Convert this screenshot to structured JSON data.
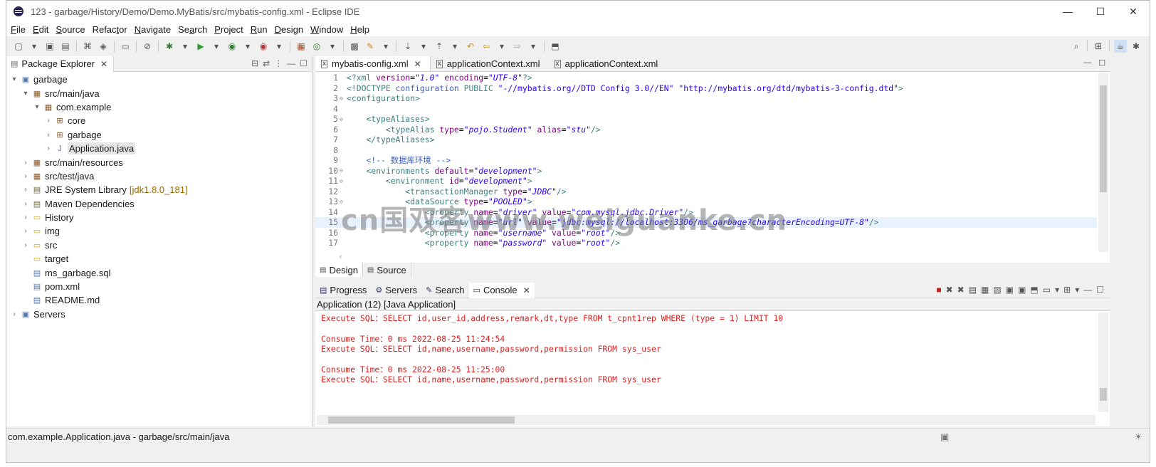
{
  "window": {
    "title": "123 - garbage/History/Demo/Demo.MyBatis/src/mybatis-config.xml - Eclipse IDE",
    "minimize": "—",
    "maximize": "☐",
    "close": "✕"
  },
  "menu": [
    {
      "mnemonic": "F",
      "rest": "ile"
    },
    {
      "mnemonic": "E",
      "rest": "dit"
    },
    {
      "mnemonic": "S",
      "rest": "ource"
    },
    {
      "mnemonic": "",
      "rest": "Refac",
      "u": "t",
      "tail": "or"
    },
    {
      "mnemonic": "N",
      "rest": "avigate"
    },
    {
      "mnemonic": "",
      "rest": "Se",
      "u": "a",
      "tail": "rch"
    },
    {
      "mnemonic": "P",
      "rest": "roject"
    },
    {
      "mnemonic": "R",
      "rest": "un"
    },
    {
      "mnemonic": "D",
      "rest": "esign"
    },
    {
      "mnemonic": "W",
      "rest": "indow"
    },
    {
      "mnemonic": "H",
      "rest": "elp"
    }
  ],
  "package_explorer": {
    "tab_label": "Package Explorer",
    "tree": [
      {
        "indent": 0,
        "twisty": "▾",
        "icon": "project-icon",
        "glyph": "▣",
        "label": "garbage"
      },
      {
        "indent": 1,
        "twisty": "▾",
        "icon": "source-folder-icon",
        "glyph": "▦",
        "label": "src/main/java"
      },
      {
        "indent": 2,
        "twisty": "▾",
        "icon": "package-icon",
        "glyph": "▦",
        "label": "com.example"
      },
      {
        "indent": 3,
        "twisty": "›",
        "icon": "package-icon",
        "glyph": "⊞",
        "label": "core"
      },
      {
        "indent": 3,
        "twisty": "›",
        "icon": "package-icon",
        "glyph": "⊞",
        "label": "garbage"
      },
      {
        "indent": 3,
        "twisty": "›",
        "icon": "java-file-icon",
        "glyph": "J",
        "label": "Application.java",
        "selected": true
      },
      {
        "indent": 1,
        "twisty": "›",
        "icon": "source-folder-icon",
        "glyph": "▦",
        "label": "src/main/resources"
      },
      {
        "indent": 1,
        "twisty": "›",
        "icon": "source-folder-icon",
        "glyph": "▦",
        "label": "src/test/java"
      },
      {
        "indent": 1,
        "twisty": "›",
        "icon": "library-icon",
        "glyph": "▤",
        "label": "JRE System Library",
        "suffix": "[jdk1.8.0_181]"
      },
      {
        "indent": 1,
        "twisty": "›",
        "icon": "library-icon",
        "glyph": "▤",
        "label": "Maven Dependencies"
      },
      {
        "indent": 1,
        "twisty": "›",
        "icon": "folder-icon",
        "glyph": "▭",
        "label": "History"
      },
      {
        "indent": 1,
        "twisty": "›",
        "icon": "folder-icon",
        "glyph": "▭",
        "label": "img"
      },
      {
        "indent": 1,
        "twisty": "›",
        "icon": "folder-icon",
        "glyph": "▭",
        "label": "src"
      },
      {
        "indent": 1,
        "twisty": "",
        "icon": "folder-icon",
        "glyph": "▭",
        "label": "target"
      },
      {
        "indent": 1,
        "twisty": "",
        "icon": "sql-file-icon",
        "glyph": "▤",
        "label": "ms_garbage.sql"
      },
      {
        "indent": 1,
        "twisty": "",
        "icon": "xml-file-icon",
        "glyph": "▤",
        "label": "pom.xml"
      },
      {
        "indent": 1,
        "twisty": "",
        "icon": "md-file-icon",
        "glyph": "▤",
        "label": "README.md"
      },
      {
        "indent": 0,
        "twisty": "›",
        "icon": "servers-icon",
        "glyph": "▣",
        "label": "Servers"
      }
    ]
  },
  "editor": {
    "tabs": [
      {
        "label": "mybatis-config.xml",
        "active": true,
        "closable": true
      },
      {
        "label": "applicationContext.xml",
        "active": false
      },
      {
        "label": "applicationContext.xml",
        "active": false
      }
    ],
    "lines": [
      {
        "n": "1",
        "fold": "",
        "segs": [
          [
            "pi",
            "<?xml "
          ],
          [
            "attr",
            "version"
          ],
          [
            "plain",
            "="
          ],
          [
            "val",
            "\"1.0\""
          ],
          [
            "plain",
            " "
          ],
          [
            "attr",
            "encoding"
          ],
          [
            "plain",
            "="
          ],
          [
            "val",
            "\"UTF-8\""
          ],
          [
            "pi",
            "?>"
          ]
        ]
      },
      {
        "n": "2",
        "fold": "",
        "segs": [
          [
            "tag",
            "<!DOCTYPE "
          ],
          [
            "decl",
            "configuration"
          ],
          [
            "tag",
            " PUBLIC "
          ],
          [
            "val2",
            "\"-//mybatis.org//DTD Config 3.0//EN\""
          ],
          [
            "tag",
            " "
          ],
          [
            "val2",
            "\"http://mybatis.org/dtd/mybatis-3-config.dtd\""
          ],
          [
            "tag",
            ">"
          ]
        ]
      },
      {
        "n": "3",
        "fold": "⊖",
        "segs": [
          [
            "tag",
            "<configuration>"
          ]
        ]
      },
      {
        "n": "4",
        "fold": "",
        "segs": [
          [
            "plain",
            ""
          ]
        ]
      },
      {
        "n": "5",
        "fold": "⊖",
        "segs": [
          [
            "plain",
            "    "
          ],
          [
            "tag",
            "<typeAliases>"
          ]
        ]
      },
      {
        "n": "6",
        "fold": "",
        "segs": [
          [
            "plain",
            "        "
          ],
          [
            "tag",
            "<typeAlias "
          ],
          [
            "attr",
            "type"
          ],
          [
            "plain",
            "="
          ],
          [
            "val",
            "\"pojo.Student\""
          ],
          [
            "plain",
            " "
          ],
          [
            "attr",
            "alias"
          ],
          [
            "plain",
            "="
          ],
          [
            "val",
            "\"stu\""
          ],
          [
            "tag",
            "/>"
          ]
        ]
      },
      {
        "n": "7",
        "fold": "",
        "segs": [
          [
            "plain",
            "    "
          ],
          [
            "tag",
            "</typeAliases>"
          ]
        ]
      },
      {
        "n": "8",
        "fold": "",
        "segs": [
          [
            "plain",
            ""
          ]
        ]
      },
      {
        "n": "9",
        "fold": "",
        "segs": [
          [
            "plain",
            "    "
          ],
          [
            "com",
            "<!-- 数据库环境 -->"
          ]
        ]
      },
      {
        "n": "10",
        "fold": "⊖",
        "segs": [
          [
            "plain",
            "    "
          ],
          [
            "tag",
            "<environments "
          ],
          [
            "attr",
            "default"
          ],
          [
            "plain",
            "="
          ],
          [
            "val",
            "\"development\""
          ],
          [
            "tag",
            ">"
          ]
        ]
      },
      {
        "n": "11",
        "fold": "⊖",
        "segs": [
          [
            "plain",
            "        "
          ],
          [
            "tag",
            "<environment "
          ],
          [
            "attr",
            "id"
          ],
          [
            "plain",
            "="
          ],
          [
            "val",
            "\"development\""
          ],
          [
            "tag",
            ">"
          ]
        ]
      },
      {
        "n": "12",
        "fold": "",
        "segs": [
          [
            "plain",
            "            "
          ],
          [
            "tag",
            "<transactionManager "
          ],
          [
            "attr",
            "type"
          ],
          [
            "plain",
            "="
          ],
          [
            "val",
            "\"JDBC\""
          ],
          [
            "tag",
            "/>"
          ]
        ]
      },
      {
        "n": "13",
        "fold": "⊖",
        "segs": [
          [
            "plain",
            "            "
          ],
          [
            "tag",
            "<dataSource "
          ],
          [
            "attr",
            "type"
          ],
          [
            "plain",
            "="
          ],
          [
            "val",
            "\"POOLED\""
          ],
          [
            "tag",
            ">"
          ]
        ]
      },
      {
        "n": "14",
        "fold": "",
        "segs": [
          [
            "plain",
            "                "
          ],
          [
            "tag",
            "<property "
          ],
          [
            "attr",
            "name"
          ],
          [
            "plain",
            "="
          ],
          [
            "val",
            "\"driver\""
          ],
          [
            "plain",
            " "
          ],
          [
            "attr",
            "value"
          ],
          [
            "plain",
            "="
          ],
          [
            "val",
            "\"com.mysql.jdbc.Driver\""
          ],
          [
            "tag",
            "/>"
          ]
        ]
      },
      {
        "n": "15",
        "fold": "",
        "current": true,
        "segs": [
          [
            "plain",
            "                "
          ],
          [
            "tag",
            "<property "
          ],
          [
            "attr",
            "name"
          ],
          [
            "plain",
            "="
          ],
          [
            "val",
            "\"url\""
          ],
          [
            "plain",
            " "
          ],
          [
            "attr",
            "value"
          ],
          [
            "plain",
            "="
          ],
          [
            "val",
            "\"jdbc:mysql://localhost:3306/ms_garbage?characterEncoding=UTF-8\""
          ],
          [
            "tag",
            "/>"
          ]
        ]
      },
      {
        "n": "16",
        "fold": "",
        "segs": [
          [
            "plain",
            "                "
          ],
          [
            "tag",
            "<property "
          ],
          [
            "attr",
            "name"
          ],
          [
            "plain",
            "="
          ],
          [
            "val",
            "\"username\""
          ],
          [
            "plain",
            " "
          ],
          [
            "attr",
            "value"
          ],
          [
            "plain",
            "="
          ],
          [
            "val",
            "\"root\""
          ],
          [
            "tag",
            "/>"
          ]
        ]
      },
      {
        "n": "17",
        "fold": "",
        "segs": [
          [
            "plain",
            "                "
          ],
          [
            "tag",
            "<property "
          ],
          [
            "attr",
            "name"
          ],
          [
            "plain",
            "="
          ],
          [
            "val",
            "\"password\""
          ],
          [
            "plain",
            " "
          ],
          [
            "attr",
            "value"
          ],
          [
            "plain",
            "="
          ],
          [
            "val",
            "\"root\""
          ],
          [
            "tag",
            "/>"
          ]
        ]
      }
    ],
    "bottom_tabs": [
      {
        "label": "Design",
        "active": true
      },
      {
        "label": "Source",
        "active": false
      }
    ]
  },
  "console": {
    "tabs": [
      {
        "label": "Progress",
        "icon": "progress-icon"
      },
      {
        "label": "Servers",
        "icon": "servers-icon"
      },
      {
        "label": "Search",
        "icon": "search-icon"
      },
      {
        "label": "Console",
        "icon": "console-icon",
        "active": true
      }
    ],
    "header": "Application (12) [Java Application]",
    "lines": [
      "Execute SQL：SELECT id,user_id,address,remark,dt,type FROM t_cpnt1rep WHERE (type = 1) LIMIT 10",
      "",
      "Consume Time：0 ms 2022-08-25 11:24:54",
      "Execute SQL：SELECT id,name,username,password,permission FROM sys_user",
      "",
      "Consume Time：0 ms 2022-08-25 11:25:00",
      "Execute SQL：SELECT id,name,username,password,permission FROM sys_user"
    ]
  },
  "status": {
    "text": "com.example.Application.java - garbage/src/main/java"
  },
  "watermark": "cn国双客www.weiguanke.cn",
  "colors": {
    "console_text": "#e02020",
    "xml_tag": "#3f7f7f",
    "xml_attr": "#7f007f",
    "xml_value": "#2a00ff"
  }
}
